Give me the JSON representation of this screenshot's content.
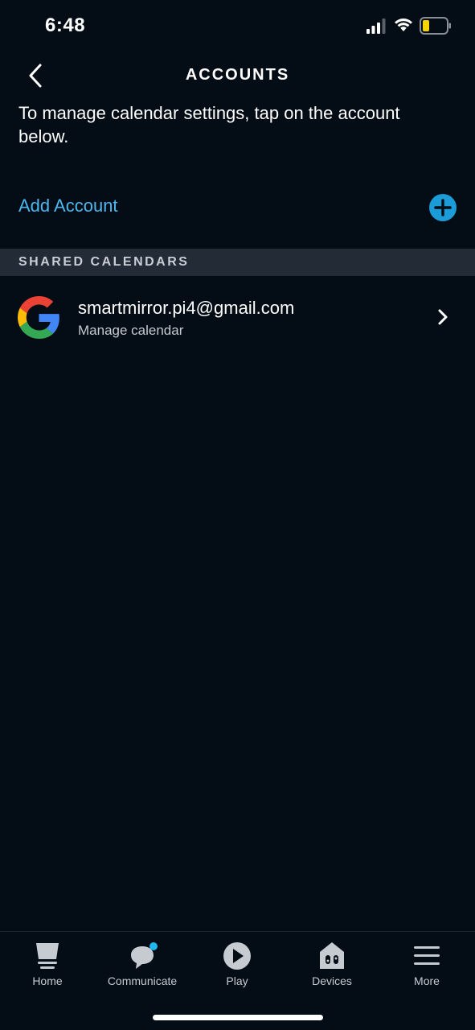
{
  "status_bar": {
    "time": "6:48",
    "icons": [
      "signal-icon",
      "wifi-icon",
      "battery-icon"
    ],
    "battery_color": "#f5d400"
  },
  "header": {
    "title": "ACCOUNTS",
    "back_icon": "chevron-left-icon"
  },
  "intro": {
    "text": "To manage calendar settings, tap on the account below."
  },
  "add_account": {
    "label": "Add Account",
    "icon": "plus-circle-icon",
    "accent_color": "#4bb8f0"
  },
  "section": {
    "title": "SHARED CALENDARS"
  },
  "accounts": [
    {
      "email": "smartmirror.pi4@gmail.com",
      "subtitle": "Manage calendar",
      "icon": "google-icon"
    }
  ],
  "tab_bar": {
    "tabs": [
      {
        "label": "Home",
        "icon": "home-icon"
      },
      {
        "label": "Communicate",
        "icon": "communicate-icon",
        "badge": true
      },
      {
        "label": "Play",
        "icon": "play-icon"
      },
      {
        "label": "Devices",
        "icon": "devices-icon"
      },
      {
        "label": "More",
        "icon": "menu-icon"
      }
    ]
  }
}
